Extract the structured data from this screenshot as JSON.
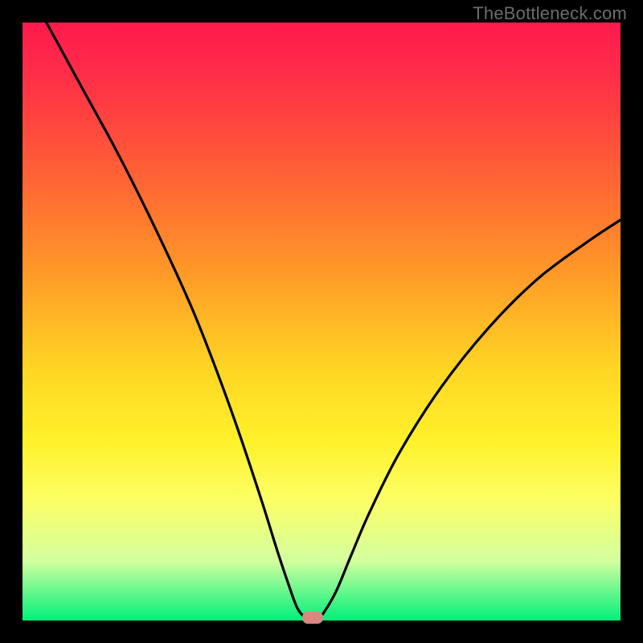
{
  "watermark": "TheBottleneck.com",
  "chart_data": {
    "type": "line",
    "title": "",
    "xlabel": "",
    "ylabel": "",
    "xlim": [
      0,
      100
    ],
    "ylim": [
      0,
      100
    ],
    "series": [
      {
        "name": "bottleneck-curve",
        "x": [
          4,
          10,
          16,
          22,
          28,
          32,
          36,
          40,
          42.5,
          44.5,
          46,
          47.5,
          49.5,
          50.5,
          52.5,
          55,
          58,
          63,
          70,
          78,
          86,
          94,
          100
        ],
        "values": [
          100,
          89,
          78,
          66,
          53,
          43,
          32,
          20,
          12,
          6,
          2,
          0.5,
          0.5,
          1.5,
          5,
          11,
          18,
          28,
          39,
          49,
          57,
          63,
          67
        ]
      }
    ],
    "marker": {
      "x": 48.5,
      "y": 0.3,
      "color": "#d98880"
    },
    "gradient_stops": [
      {
        "pos": 0,
        "color": "#ff1a4d"
      },
      {
        "pos": 0.5,
        "color": "#ffd624"
      },
      {
        "pos": 0.8,
        "color": "#fcff66"
      },
      {
        "pos": 1,
        "color": "#00f07a"
      }
    ]
  }
}
